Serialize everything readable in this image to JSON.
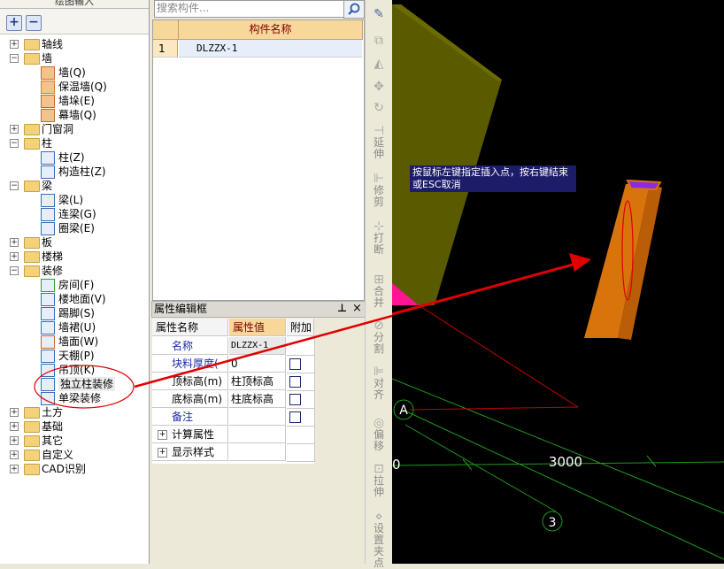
{
  "left_panel": {
    "title": "绘图输入",
    "tree": [
      {
        "label": "轴线",
        "level": 0,
        "expander": "+"
      },
      {
        "label": "墙",
        "level": 0,
        "expander": "-",
        "open": true
      },
      {
        "label": "墙(Q)",
        "level": 1,
        "icon": "wall-icon"
      },
      {
        "label": "保温墙(Q)",
        "level": 1,
        "icon": "insulation-wall-icon"
      },
      {
        "label": "墙垛(E)",
        "level": 1,
        "icon": "wall-pier-icon"
      },
      {
        "label": "幕墙(Q)",
        "level": 1,
        "icon": "curtain-wall-icon"
      },
      {
        "label": "门窗洞",
        "level": 0,
        "expander": "+"
      },
      {
        "label": "柱",
        "level": 0,
        "expander": "-",
        "open": true
      },
      {
        "label": "柱(Z)",
        "level": 1,
        "icon": "column-icon"
      },
      {
        "label": "构造柱(Z)",
        "level": 1,
        "icon": "constructional-column-icon"
      },
      {
        "label": "梁",
        "level": 0,
        "expander": "-",
        "open": true
      },
      {
        "label": "梁(L)",
        "level": 1,
        "icon": "beam-icon"
      },
      {
        "label": "连梁(G)",
        "level": 1,
        "icon": "link-beam-icon"
      },
      {
        "label": "圈梁(E)",
        "level": 1,
        "icon": "ring-beam-icon"
      },
      {
        "label": "板",
        "level": 0,
        "expander": "+"
      },
      {
        "label": "楼梯",
        "level": 0,
        "expander": "+"
      },
      {
        "label": "装修",
        "level": 0,
        "expander": "-",
        "open": true
      },
      {
        "label": "房间(F)",
        "level": 1,
        "icon": "room-icon"
      },
      {
        "label": "楼地面(V)",
        "level": 1,
        "icon": "floor-icon"
      },
      {
        "label": "踢脚(S)",
        "level": 1,
        "icon": "skirting-icon"
      },
      {
        "label": "墙裙(U)",
        "level": 1,
        "icon": "dado-icon"
      },
      {
        "label": "墙面(W)",
        "level": 1,
        "icon": "wall-face-icon"
      },
      {
        "label": "天棚(P)",
        "level": 1,
        "icon": "ceiling-icon"
      },
      {
        "label": "吊顶(K)",
        "level": 1,
        "icon": "suspended-ceiling-icon"
      },
      {
        "label": "独立柱装修",
        "level": 1,
        "icon": "column-finish-icon",
        "selected": true
      },
      {
        "label": "单梁装修",
        "level": 1,
        "icon": "beam-finish-icon"
      },
      {
        "label": "土方",
        "level": 0,
        "expander": "+"
      },
      {
        "label": "基础",
        "level": 0,
        "expander": "+"
      },
      {
        "label": "其它",
        "level": 0,
        "expander": "+"
      },
      {
        "label": "自定义",
        "level": 0,
        "expander": "+"
      },
      {
        "label": "CAD识别",
        "level": 0,
        "expander": "+"
      }
    ]
  },
  "component_list": {
    "search_placeholder": "搜索构件...",
    "header": "构件名称",
    "rows": [
      {
        "index": "1",
        "name": "DLZZX-1"
      }
    ]
  },
  "property_panel": {
    "title": "属性编辑框",
    "pin_glyph": "ᵖ",
    "close_glyph": "×",
    "headers": [
      "属性名称",
      "属性值",
      "附加"
    ],
    "rows": [
      {
        "name": "名称",
        "value": "DLZZX-1",
        "checkbox": false,
        "blue": true,
        "expander": ""
      },
      {
        "name": "块料厚度(",
        "value": "0",
        "checkbox": true,
        "blue": true,
        "expander": ""
      },
      {
        "name": "顶标高(m)",
        "value": "柱顶标高",
        "checkbox": true,
        "blue": false,
        "expander": ""
      },
      {
        "name": "底标高(m)",
        "value": "柱底标高",
        "checkbox": true,
        "blue": false,
        "expander": ""
      },
      {
        "name": "备注",
        "value": "",
        "checkbox": true,
        "blue": true,
        "expander": ""
      },
      {
        "name": "计算属性",
        "value": "",
        "checkbox": false,
        "blue": false,
        "expander": "+"
      },
      {
        "name": "显示样式",
        "value": "",
        "checkbox": false,
        "blue": false,
        "expander": "+"
      }
    ]
  },
  "toolbar": {
    "items": [
      {
        "label": "",
        "icon": "pen-icon"
      },
      {
        "label": "",
        "icon": "copy-icon"
      },
      {
        "label": "",
        "icon": "mirror-icon"
      },
      {
        "label": "",
        "icon": "move-icon"
      },
      {
        "label": "",
        "icon": "rotate-icon"
      },
      {
        "label": "延伸",
        "icon": "extend-icon"
      },
      {
        "label": "修剪",
        "icon": "trim-icon"
      },
      {
        "label": "打断",
        "icon": "break-icon"
      },
      {
        "label": "合并",
        "icon": "merge-icon"
      },
      {
        "label": "分割",
        "icon": "split-icon"
      },
      {
        "label": "对齐",
        "icon": "align-icon"
      },
      {
        "label": "偏移",
        "icon": "offset-icon"
      },
      {
        "label": "拉伸",
        "icon": "stretch-icon"
      },
      {
        "label": "设置夹点",
        "icon": "grip-icon"
      }
    ]
  },
  "canvas": {
    "tooltip": "按鼠标左键指定插入点，按右键结束或ESC取消",
    "axis_labels": {
      "a": "A",
      "three": "3"
    },
    "dimension": "3000",
    "dimension_left": "0",
    "colors": {
      "background": "#000000",
      "wall": "#5a5a00",
      "column": "#d8740c",
      "column_top": "#8a2be2",
      "axis": "#1e9b1e",
      "annotation": "#e00000"
    }
  }
}
